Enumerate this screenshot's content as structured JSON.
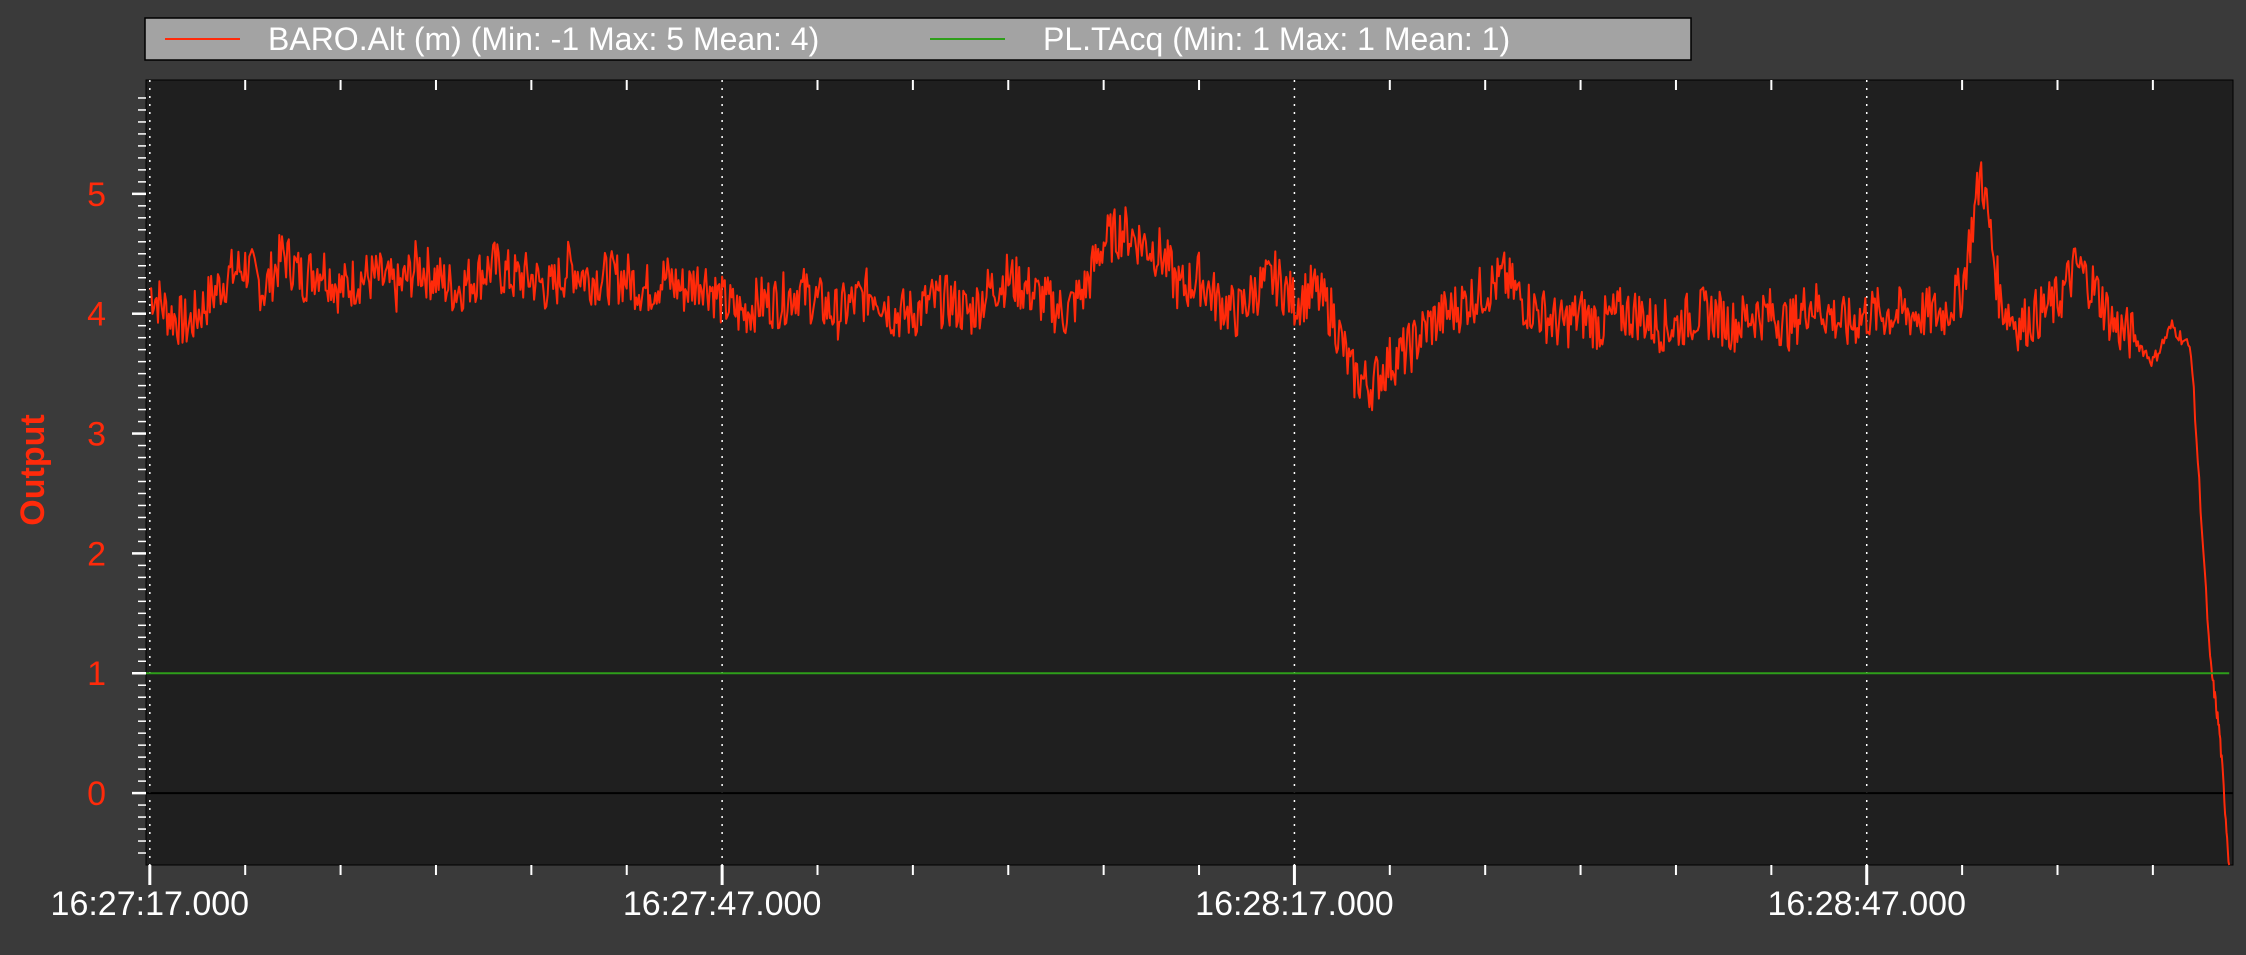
{
  "colors": {
    "background": "#3a3a3a",
    "plot_area": "#1f1f1f",
    "legend_box": "#a3a3a3",
    "baro_series": "#ff2a0a",
    "pl_series": "#2e9e1a",
    "y_axis_text": "#ff2a0a",
    "x_axis_text": "#ffffff",
    "grid": "#ffffff",
    "zero_line": "#000000"
  },
  "legend": {
    "position": "top-left",
    "entries": [
      "BARO.Alt (m) (Min: -1 Max: 5 Mean: 4)",
      "PL.TAcq (Min: 1 Max: 1 Mean: 1)"
    ]
  },
  "chart_data": {
    "type": "line",
    "title": "",
    "xlabel": "",
    "ylabel": "Output",
    "x_tick_labels": [
      "16:27:17.000",
      "16:27:47.000",
      "16:28:17.000",
      "16:28:47.000"
    ],
    "x_tick_seconds": [
      0,
      30,
      60,
      90
    ],
    "y_tick_labels": [
      "0",
      "1",
      "2",
      "3",
      "4",
      "5"
    ],
    "xlim": [
      -0.2,
      109.2
    ],
    "ylim": [
      -0.6,
      5.95
    ],
    "grid": "vertical-dotted",
    "series": [
      {
        "name": "BARO.Alt (m) (Min: -1 Max: 5 Mean: 4)",
        "color": "#ff2a0a",
        "x": [
          0,
          1,
          2,
          3,
          4,
          5,
          6,
          7,
          8,
          9,
          10,
          11,
          12,
          13,
          14,
          15,
          16,
          17,
          18,
          19,
          20,
          21,
          22,
          23,
          24,
          25,
          26,
          27,
          28,
          29,
          30,
          31,
          32,
          33,
          34,
          35,
          36,
          37,
          38,
          39,
          40,
          41,
          42,
          43,
          44,
          45,
          46,
          47,
          48,
          49,
          50,
          51,
          52,
          53,
          54,
          55,
          56,
          57,
          58,
          59,
          60,
          61,
          62,
          63,
          64,
          65,
          66,
          67,
          68,
          69,
          70,
          71,
          72,
          73,
          74,
          75,
          76,
          77,
          78,
          79,
          80,
          81,
          82,
          83,
          84,
          85,
          86,
          87,
          88,
          89,
          90,
          91,
          92,
          93,
          94,
          95,
          96,
          97,
          98,
          99,
          100,
          101,
          102,
          103,
          104,
          105,
          106,
          107,
          108,
          108.5,
          109
        ],
        "y": [
          4.2,
          4.0,
          3.9,
          4.1,
          4.3,
          4.4,
          4.2,
          4.5,
          4.3,
          4.4,
          4.2,
          4.3,
          4.3,
          4.2,
          4.4,
          4.3,
          4.2,
          4.3,
          4.4,
          4.3,
          4.3,
          4.2,
          4.4,
          4.3,
          4.3,
          4.3,
          4.2,
          4.3,
          4.2,
          4.3,
          4.1,
          4.0,
          4.1,
          4.1,
          4.2,
          4.1,
          4.0,
          4.1,
          4.2,
          4.0,
          4.0,
          4.1,
          4.1,
          4.0,
          4.2,
          4.3,
          4.2,
          4.1,
          4.0,
          4.2,
          4.6,
          4.7,
          4.6,
          4.5,
          4.2,
          4.3,
          4.1,
          4.0,
          4.2,
          4.3,
          4.1,
          4.2,
          4.0,
          3.5,
          3.4,
          3.6,
          3.7,
          3.9,
          4.0,
          4.1,
          4.2,
          4.3,
          4.1,
          4.0,
          3.9,
          4.0,
          3.9,
          4.0,
          4.0,
          3.9,
          3.9,
          4.0,
          4.0,
          3.9,
          4.0,
          4.0,
          3.9,
          4.1,
          4.0,
          3.9,
          4.0,
          4.0,
          4.0,
          4.0,
          4.0,
          4.2,
          5.2,
          4.1,
          3.9,
          4.0,
          4.1,
          4.4,
          4.2,
          3.9,
          3.8,
          3.6,
          3.9,
          3.7,
          1.1,
          0.5,
          -0.6
        ]
      },
      {
        "name": "PL.TAcq (Min: 1 Max: 1 Mean: 1)",
        "color": "#2e9e1a",
        "x": [
          -0.2,
          109
        ],
        "y": [
          1,
          1
        ]
      }
    ]
  }
}
